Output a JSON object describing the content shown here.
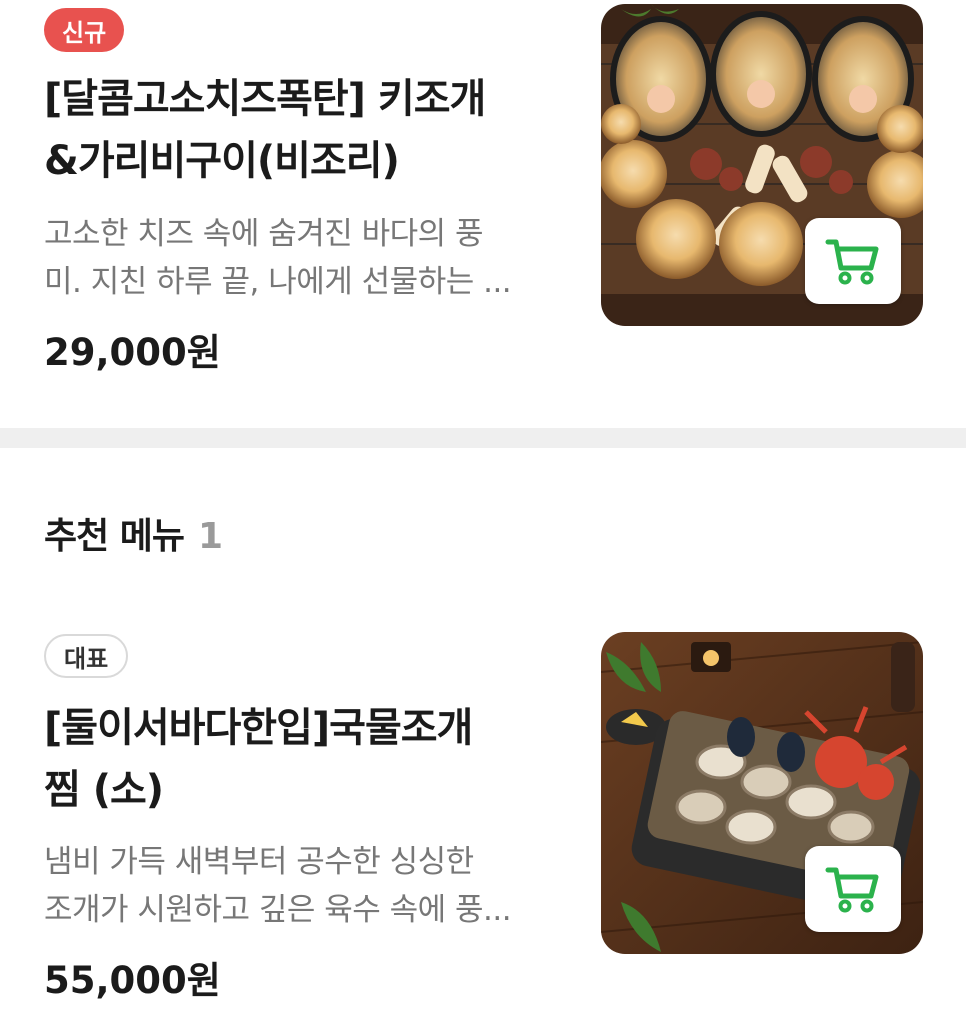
{
  "items": [
    {
      "badge": "신규",
      "title_line1": "[달콤고소치즈폭탄] 키조개",
      "title_line2": "&가리비구이(비조리)",
      "desc_line1": "고소한 치즈 속에 숨겨진 바다의 풍",
      "desc_line2": "미. 지친 하루 끝, 나에게 선물하는 ...",
      "price": "29,000원",
      "image": "grilled-scallops-cheese-photo",
      "cart_icon": "cart-icon"
    },
    {
      "badge": "대표",
      "title_line1": "[둘이서바다한입]국물조개",
      "title_line2": "찜 (소)",
      "desc_line1": "냄비 가득 새벽부터 공수한 싱싱한",
      "desc_line2": "조개가 시원하고 깊은 육수 속에 풍...",
      "price": "55,000원",
      "image": "steamed-clams-pot-photo",
      "cart_icon": "cart-icon"
    }
  ],
  "section": {
    "title": "추천 메뉴",
    "count": "1"
  },
  "colors": {
    "new_badge": "#e8524f",
    "cart_green": "#2bb24c",
    "divider": "#efefef"
  }
}
